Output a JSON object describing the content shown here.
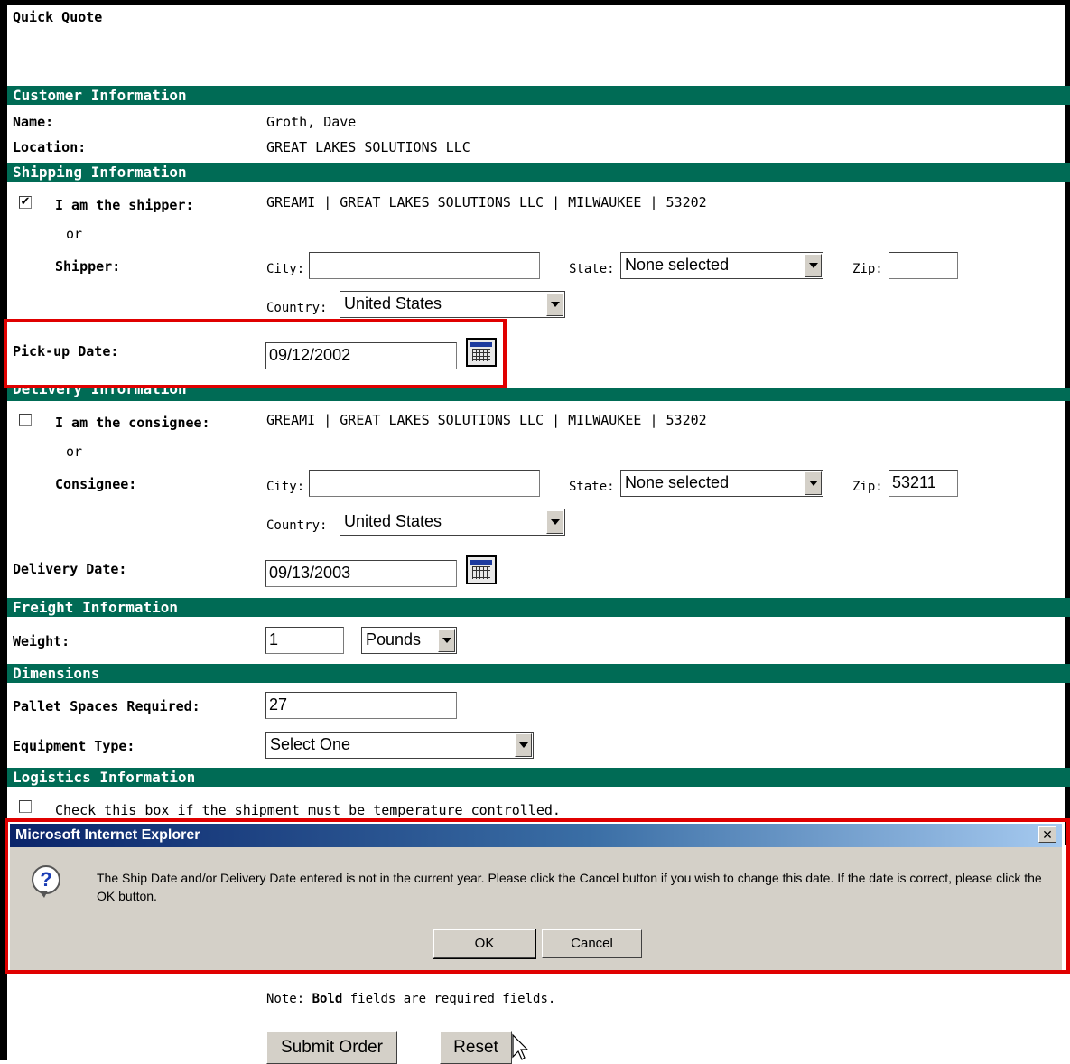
{
  "page": {
    "title": "Quick Quote"
  },
  "customer": {
    "header": "Customer Information",
    "name_label": "Name:",
    "name_value": "Groth, Dave",
    "location_label": "Location:",
    "location_value": "GREAT LAKES SOLUTIONS LLC"
  },
  "shipping": {
    "header": "Shipping Information",
    "i_am_shipper_label": "I am the shipper:",
    "i_am_shipper_checked": true,
    "shipper_info": "GREAMI | GREAT LAKES SOLUTIONS LLC | MILWAUKEE | 53202",
    "or": "or",
    "shipper_label": "Shipper:",
    "city_label": "City:",
    "city_value": "",
    "state_label": "State:",
    "state_value": "None selected",
    "zip_label": "Zip:",
    "zip_value": "",
    "country_label": "Country:",
    "country_value": "United States",
    "pickup_label": "Pick-up Date:",
    "pickup_value": "09/12/2002"
  },
  "delivery": {
    "header": "Delivery Information",
    "i_am_consignee_label": "I am the consignee:",
    "i_am_consignee_checked": false,
    "consignee_info": "GREAMI | GREAT LAKES SOLUTIONS LLC | MILWAUKEE | 53202",
    "or": "or",
    "consignee_label": "Consignee:",
    "city_label": "City:",
    "city_value": "",
    "state_label": "State:",
    "state_value": "None selected",
    "zip_label": "Zip:",
    "zip_value": "53211",
    "country_label": "Country:",
    "country_value": "United States",
    "delivery_date_label": "Delivery Date:",
    "delivery_date_value": "09/13/2003"
  },
  "freight": {
    "header": "Freight Information",
    "weight_label": "Weight:",
    "weight_value": "1",
    "unit_value": "Pounds"
  },
  "dimensions": {
    "header": "Dimensions",
    "pallet_label": "Pallet Spaces Required:",
    "pallet_value": "27",
    "equipment_label": "Equipment Type:",
    "equipment_value": "Select One"
  },
  "logistics": {
    "header": "Logistics Information",
    "temp_label": "Check this box if the shipment must be temperature controlled.",
    "temp_checked": false
  },
  "dialog": {
    "title": "Microsoft Internet Explorer",
    "close_label": "✕",
    "message": "The Ship Date and/or Delivery Date entered is not in the current year.  Please click the Cancel button if you wish to change this date.  If the date is correct, please click the OK button.",
    "ok_label": "OK",
    "cancel_label": "Cancel",
    "icon": "question-icon"
  },
  "footer": {
    "note_prefix": "Note: ",
    "note_bold": "Bold",
    "note_suffix": " fields are required fields.",
    "submit_label": "Submit Order",
    "reset_label": "Reset"
  },
  "colors": {
    "band": "#006b55",
    "highlight": "#e00000",
    "dialog_title_start": "#0a246a"
  }
}
